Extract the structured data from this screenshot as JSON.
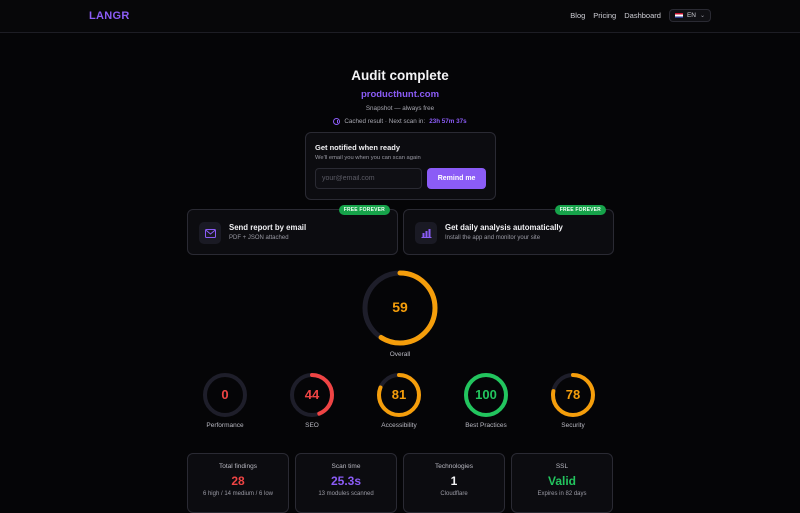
{
  "header": {
    "logo": "LANGR",
    "nav": [
      "Blog",
      "Pricing",
      "Dashboard"
    ],
    "language": "EN"
  },
  "hero": {
    "title": "Audit complete",
    "domain": "producthunt.com",
    "snapshot": "Snapshot — always free",
    "cached_label": "Cached result · Next scan in:",
    "countdown": "23h 57m 37s"
  },
  "notify": {
    "title": "Get notified when ready",
    "subtitle": "We'll email you when you can scan again",
    "email_placeholder": "your@email.com",
    "button": "Remind me"
  },
  "cards": [
    {
      "badge": "FREE FOREVER",
      "title": "Send report by email",
      "subtitle": "PDF + JSON attached",
      "icon": "mail-icon"
    },
    {
      "badge": "FREE FOREVER",
      "title": "Get daily analysis automatically",
      "subtitle": "Install the app and monitor your site",
      "icon": "bar-chart-icon"
    }
  ],
  "overall": {
    "score": "59",
    "value": 59,
    "label": "Overall",
    "color": "#f59e0b"
  },
  "scores": [
    {
      "score": "0",
      "value": 0,
      "label": "Performance",
      "color": "#ef4444"
    },
    {
      "score": "44",
      "value": 44,
      "label": "SEO",
      "color": "#ef4444"
    },
    {
      "score": "81",
      "value": 81,
      "label": "Accessibility",
      "color": "#f59e0b"
    },
    {
      "score": "100",
      "value": 100,
      "label": "Best Practices",
      "color": "#22c55e"
    },
    {
      "score": "78",
      "value": 78,
      "label": "Security",
      "color": "#f59e0b"
    }
  ],
  "stats": [
    {
      "title": "Total findings",
      "value": "28",
      "sub": "6 high / 14 medium / 6 low",
      "color": "#ef4444"
    },
    {
      "title": "Scan time",
      "value": "25.3s",
      "sub": "13 modules scanned",
      "color": "#8b5cf6"
    },
    {
      "title": "Technologies",
      "value": "1",
      "sub": "Cloudflare",
      "color": "#f4f4f6"
    },
    {
      "title": "SSL",
      "value": "Valid",
      "sub": "Expires in 82 days",
      "color": "#22c55e"
    }
  ],
  "colors": {
    "accent": "#8b5cf6",
    "track": "#1e1e2a"
  }
}
